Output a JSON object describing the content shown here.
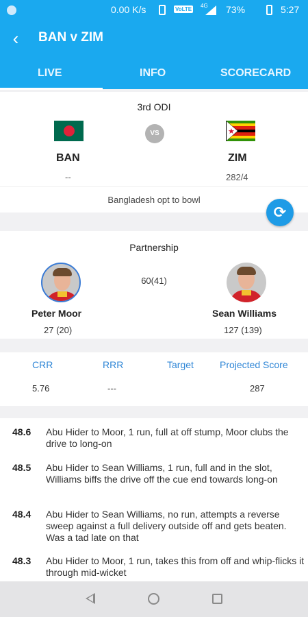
{
  "status_bar": {
    "speed": "0.00 K/s",
    "network_label": "VoLTE",
    "signal_label": "4G",
    "battery": "73%",
    "time": "5:27"
  },
  "header": {
    "title": "BAN v ZIM",
    "tabs": [
      "LIVE",
      "INFO",
      "SCORECARD"
    ],
    "active_tab": "LIVE"
  },
  "match": {
    "type": "3rd ODI",
    "vs_label": "VS",
    "team1": {
      "short": "BAN",
      "score": "--"
    },
    "team2": {
      "short": "ZIM",
      "score": "282/4"
    },
    "toss": "Bangladesh opt to bowl"
  },
  "partnership": {
    "title": "Partnership",
    "runs": "60(41)",
    "batsman1": {
      "name": "Peter Moor",
      "score": "27 (20)"
    },
    "batsman2": {
      "name": "Sean Williams",
      "score": "127 (139)"
    }
  },
  "stats": {
    "headers": [
      "CRR",
      "RRR",
      "Target",
      "Projected Score"
    ],
    "values": [
      "5.76",
      "---",
      "",
      "287"
    ]
  },
  "commentary": [
    {
      "over": "48.6",
      "text": "Abu Hider to Moor, 1 run, full at off stump, Moor clubs the drive to long-on"
    },
    {
      "over": "48.5",
      "text": "Abu Hider to Sean Williams, 1 run, full and in the slot, Williams biffs the drive off the cue end towards long-on"
    },
    {
      "over": "48.4",
      "text": "Abu Hider to Sean Williams, no run, attempts a reverse sweep against a full delivery outside off and gets beaten. Was a tad late on that"
    },
    {
      "over": "48.3",
      "text": "Abu Hider to Moor, 1 run, takes this from off and whip-flicks it through mid-wicket"
    }
  ],
  "colors": {
    "brand": "#1aa9ef",
    "accent_text": "#2f86d6",
    "refresh_button": "#1e9be6"
  }
}
